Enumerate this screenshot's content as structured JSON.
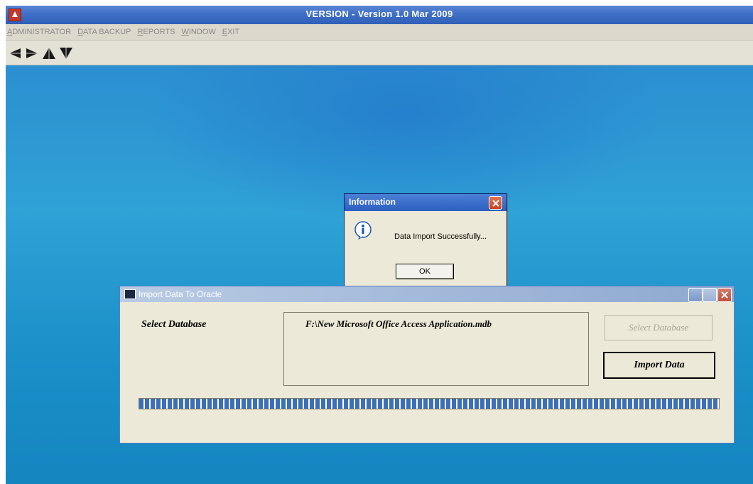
{
  "window": {
    "title": "VERSION  -  Version 1.0 Mar 2009"
  },
  "menu": {
    "items": [
      "ADMINISTRATOR",
      "DATA BACKUP",
      "REPORTS",
      "WINDOW",
      "EXIT"
    ]
  },
  "toolbar": {
    "icons": [
      "first-record-icon",
      "previous-record-icon",
      "next-record-icon",
      "last-record-icon"
    ]
  },
  "info_dialog": {
    "title": "Information",
    "message": "Data Import Successfully...",
    "ok_label": "OK"
  },
  "import_window": {
    "title": "Import Data To Oracle",
    "select_label": "Select Database",
    "db_path": "F:\\New Microsoft Office Access Application.mdb",
    "select_button": "Select Database",
    "import_button": "Import Data",
    "progress": 1.0
  },
  "colors": {
    "title_bar": "#3f6fc6",
    "desktop": "#2fa2d6",
    "progress": "#3d6fb8"
  }
}
